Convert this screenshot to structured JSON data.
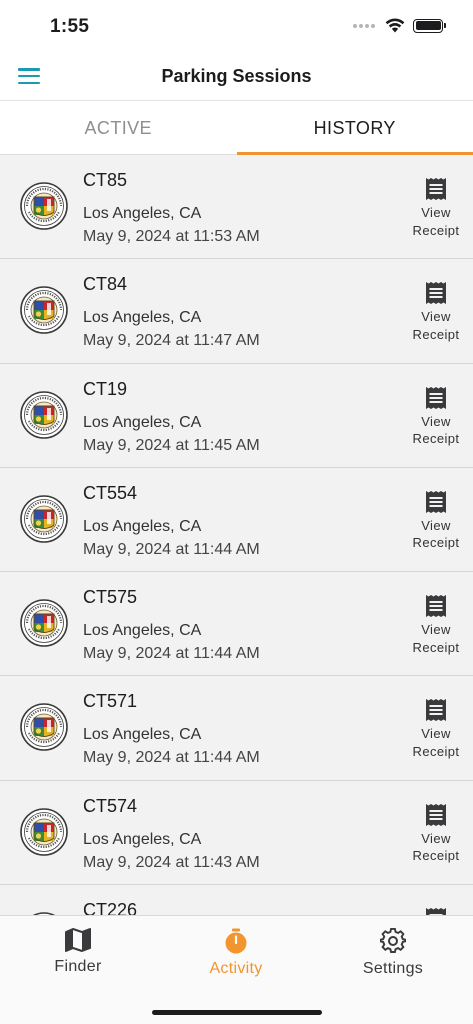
{
  "status_bar": {
    "time": "1:55"
  },
  "nav": {
    "title": "Parking Sessions"
  },
  "tabs": [
    {
      "label": "ACTIVE",
      "active": false
    },
    {
      "label": "HISTORY",
      "active": true
    }
  ],
  "sessions": [
    {
      "zone": "CT85",
      "city": "Los Angeles, CA",
      "date": "May 9, 2024 at 11:53 AM"
    },
    {
      "zone": "CT84",
      "city": "Los Angeles, CA",
      "date": "May 9, 2024 at 11:47 AM"
    },
    {
      "zone": "CT19",
      "city": "Los Angeles, CA",
      "date": "May 9, 2024 at 11:45 AM"
    },
    {
      "zone": "CT554",
      "city": "Los Angeles, CA",
      "date": "May 9, 2024 at 11:44 AM"
    },
    {
      "zone": "CT575",
      "city": "Los Angeles, CA",
      "date": "May 9, 2024 at 11:44 AM"
    },
    {
      "zone": "CT571",
      "city": "Los Angeles, CA",
      "date": "May 9, 2024 at 11:44 AM"
    },
    {
      "zone": "CT574",
      "city": "Los Angeles, CA",
      "date": "May 9, 2024 at 11:43 AM"
    },
    {
      "zone": "CT226",
      "city": "",
      "date": ""
    }
  ],
  "receipt": {
    "line1": "View",
    "line2": "Receipt"
  },
  "tab_bar": {
    "finder": "Finder",
    "activity": "Activity",
    "settings": "Settings"
  },
  "colors": {
    "accent": "#f2952e",
    "menu": "#1a9bb0",
    "row_bg": "#f2f2f2"
  },
  "icons": {
    "menu": "hamburger-icon",
    "receipt": "receipt-icon",
    "seal": "city-seal-icon",
    "finder": "map-icon",
    "activity": "timer-icon",
    "settings": "gear-icon"
  }
}
